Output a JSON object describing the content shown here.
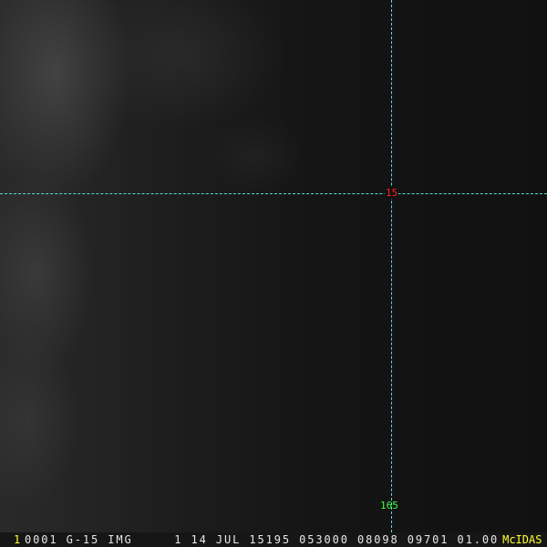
{
  "grid": {
    "latitude_label": "15",
    "longitude_label": "165",
    "line_color": "#5fd6e0"
  },
  "status_bar": {
    "frame_number": "1",
    "info": "0001 G-15 IMG     1 14 JUL 15195 053000 08098 09701 01.00",
    "brand": "McIDAS"
  },
  "colors": {
    "latitude": "#ff2020",
    "longitude": "#40ff40",
    "brand": "#ffff30"
  }
}
